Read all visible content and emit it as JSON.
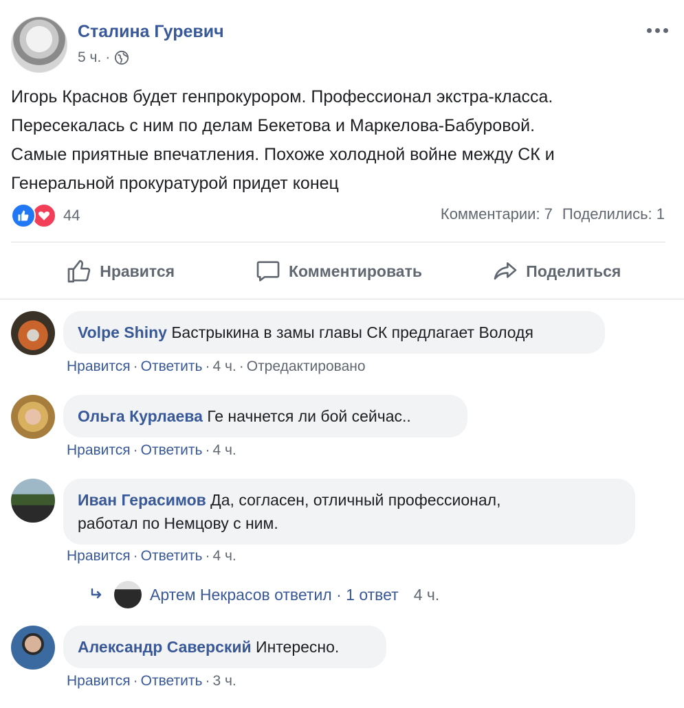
{
  "post": {
    "author": "Сталина Гуревич",
    "time": "5 ч.",
    "separator": "·",
    "text_lines": [
      "Игорь Краснов будет генпрокурором. Профессионал экстра-класса.",
      "Пересекалась с ним по делам Бекетова и Маркелова-Бабуровой.",
      "Самые приятные впечатления. Похоже холодной войне между СК и",
      "Генеральной прокуратурой придет конец"
    ],
    "reactions_count": "44",
    "comments_count": "Комментарии: 7",
    "shares_count": "Поделились: 1"
  },
  "actions": {
    "like": "Нравится",
    "comment": "Комментировать",
    "share": "Поделиться"
  },
  "comments": [
    {
      "author": "Volpe Shiny",
      "text": "Бастрыкина в замы главы СК предлагает Володя",
      "like": "Нравится",
      "reply": "Ответить",
      "time": "4 ч.",
      "edited": "Отредактировано"
    },
    {
      "author": "Ольга Курлаева",
      "text": "Ге начнется ли бой сейчас..",
      "like": "Нравится",
      "reply": "Ответить",
      "time": "4 ч."
    },
    {
      "author": "Иван Герасимов",
      "text_line1": "Да, согласен, отличный профессионал,",
      "text_line2": "работал по Немцову с ним.",
      "like": "Нравится",
      "reply": "Ответить",
      "time": "4 ч."
    },
    {
      "author": "Александр Саверский",
      "text": "Интересно.",
      "like": "Нравится",
      "reply": "Ответить",
      "time": "3 ч."
    }
  ],
  "reply_thread": {
    "text": "Артем Некрасов ответил · 1 ответ",
    "time": "4 ч."
  },
  "colors": {
    "link": "#385898",
    "meta": "#606770",
    "bubble": "#f2f3f5",
    "like_blue": "#2078f4",
    "love_red": "#f33e58"
  }
}
